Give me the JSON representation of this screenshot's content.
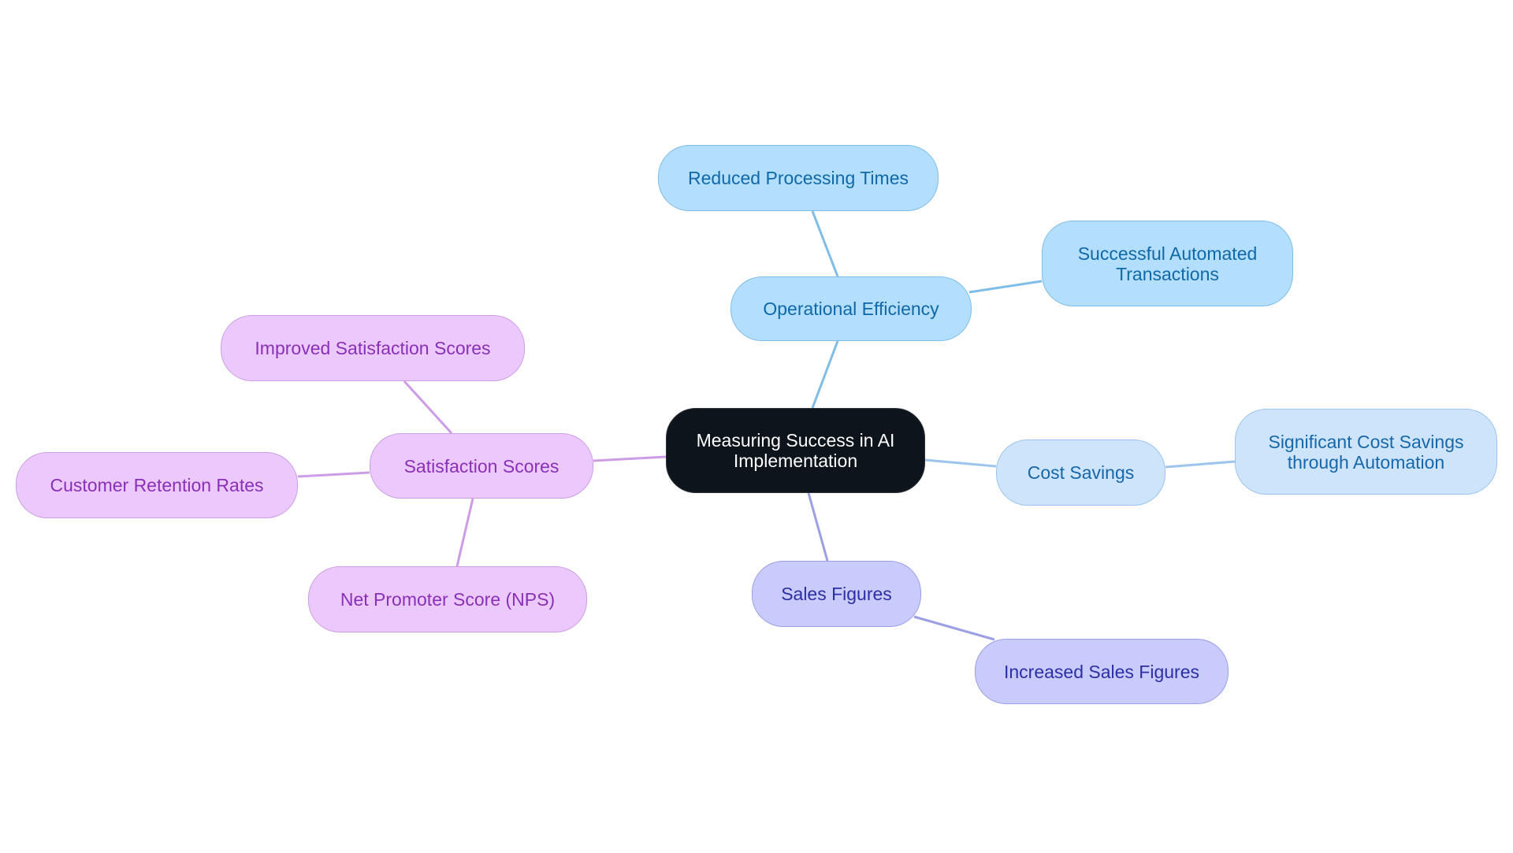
{
  "diagram": {
    "type": "mindmap",
    "root": {
      "id": "root",
      "label": "Measuring Success in AI\nImplementation",
      "color": "#0d141b"
    },
    "branches": [
      {
        "id": "operational-efficiency",
        "label": "Operational Efficiency",
        "color": "#b3defd",
        "edge_color": "#7fbde9",
        "children": [
          {
            "id": "reduced-processing-times",
            "label": "Reduced Processing Times"
          },
          {
            "id": "successful-automated-transactions",
            "label": "Successful Automated\nTransactions"
          }
        ]
      },
      {
        "id": "cost-savings",
        "label": "Cost Savings",
        "color": "#cde4fb",
        "edge_color": "#9cc4ed",
        "children": [
          {
            "id": "significant-cost-savings",
            "label": "Significant Cost Savings\nthrough Automation"
          }
        ]
      },
      {
        "id": "sales-figures",
        "label": "Sales Figures",
        "color": "#c9cbfd",
        "edge_color": "#9c9fe6",
        "children": [
          {
            "id": "increased-sales-figures",
            "label": "Increased Sales Figures"
          }
        ]
      },
      {
        "id": "satisfaction-scores",
        "label": "Satisfaction Scores",
        "color": "#ecc9fd",
        "edge_color": "#cc9de6",
        "children": [
          {
            "id": "improved-satisfaction-scores",
            "label": "Improved Satisfaction Scores"
          },
          {
            "id": "customer-retention-rates",
            "label": "Customer Retention Rates"
          },
          {
            "id": "net-promoter-score",
            "label": "Net Promoter Score (NPS)"
          }
        ]
      }
    ]
  }
}
